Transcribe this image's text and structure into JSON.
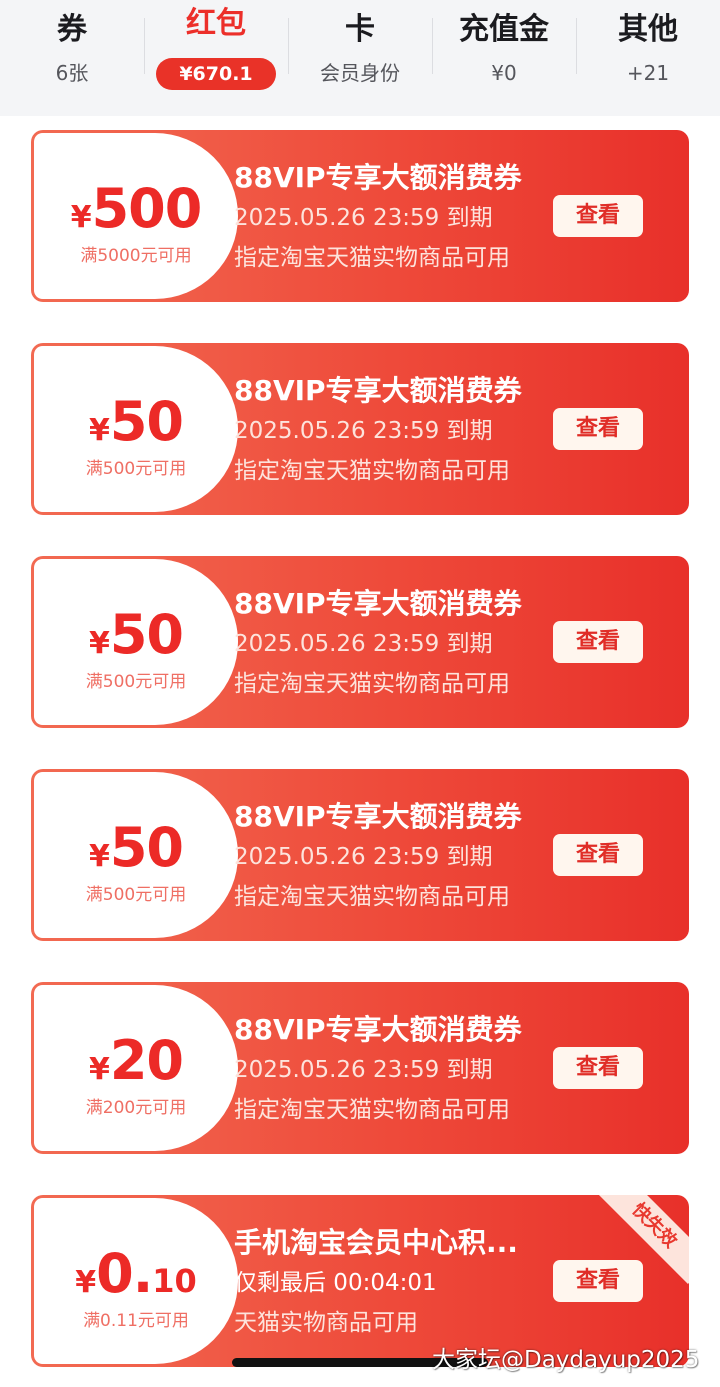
{
  "tabs": [
    {
      "title": "券",
      "sub": "6张"
    },
    {
      "title": "红包",
      "sub": "¥670.1",
      "active": true
    },
    {
      "title": "卡",
      "sub": "会员身份"
    },
    {
      "title": "充值金",
      "sub": "¥0"
    },
    {
      "title": "其他",
      "sub": "+21"
    }
  ],
  "coupons": [
    {
      "currency": "¥",
      "amount": "500",
      "decimal": "",
      "condition": "满5000元可用",
      "title": "88VIP专享大额消费券",
      "line2": "2025.05.26 23:59 到期",
      "line3": "指定淘宝天猫实物商品可用",
      "button": "查看"
    },
    {
      "currency": "¥",
      "amount": "50",
      "decimal": "",
      "condition": "满500元可用",
      "title": "88VIP专享大额消费券",
      "line2": "2025.05.26 23:59 到期",
      "line3": "指定淘宝天猫实物商品可用",
      "button": "查看"
    },
    {
      "currency": "¥",
      "amount": "50",
      "decimal": "",
      "condition": "满500元可用",
      "title": "88VIP专享大额消费券",
      "line2": "2025.05.26 23:59 到期",
      "line3": "指定淘宝天猫实物商品可用",
      "button": "查看"
    },
    {
      "currency": "¥",
      "amount": "50",
      "decimal": "",
      "condition": "满500元可用",
      "title": "88VIP专享大额消费券",
      "line2": "2025.05.26 23:59 到期",
      "line3": "指定淘宝天猫实物商品可用",
      "button": "查看"
    },
    {
      "currency": "¥",
      "amount": "20",
      "decimal": "",
      "condition": "满200元可用",
      "title": "88VIP专享大额消费券",
      "line2": "2025.05.26 23:59 到期",
      "line3": "指定淘宝天猫实物商品可用",
      "button": "查看"
    },
    {
      "currency": "¥",
      "amount": "0.",
      "decimal": "10",
      "condition": "满0.11元可用",
      "title": "手机淘宝会员中心积...",
      "line2": "仅剩最后 00:04:01",
      "line3": "天猫实物商品可用",
      "button": "查看",
      "ribbon": "快失效"
    }
  ],
  "watermark": "大家坛@Daydayup2025",
  "colors": {
    "accent": "#ec2f2a",
    "coupon_start": "#f26a52",
    "coupon_end": "#e8302a",
    "button_bg": "#fff6ee"
  }
}
